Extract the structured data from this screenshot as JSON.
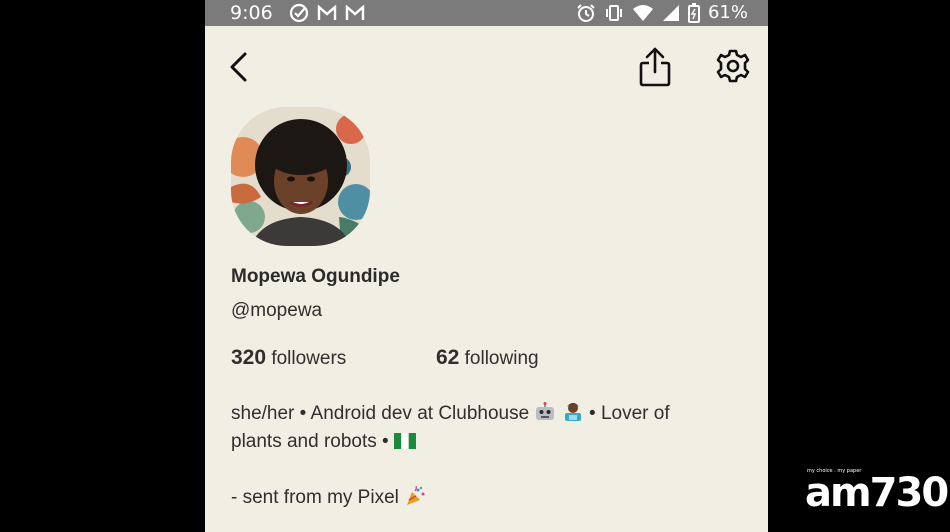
{
  "status_bar": {
    "time": "9:06",
    "battery": "61%"
  },
  "profile": {
    "name": "Mopewa Ogundipe",
    "handle": "@mopewa",
    "followers_count": "320",
    "followers_label": "followers",
    "following_count": "62",
    "following_label": "following",
    "bio_line1_text": "she/her • Android dev at Clubhouse",
    "bio_line1_tail": "• Lover of",
    "bio_line2_text": "plants and robots •",
    "bio_line3_text": "- sent from my Pixel"
  },
  "watermark": {
    "tagline": "my choice . my paper",
    "logo": "am730"
  },
  "icons": {
    "back": "back-arrow-icon",
    "share": "share-icon",
    "settings": "gear-icon"
  },
  "colors": {
    "background": "#f1efe4",
    "status_bar": "#7b7b7b",
    "text": "#2f2f2f"
  }
}
